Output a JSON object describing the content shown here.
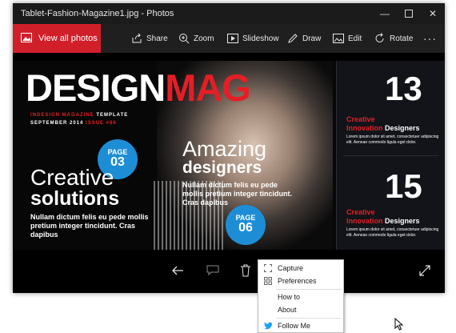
{
  "window": {
    "title": "Tablet-Fashion-Magazine1.jpg - Photos",
    "controls": [
      "minimize",
      "maximize",
      "close"
    ]
  },
  "toolbar": {
    "view_all": "View all photos",
    "share": "Share",
    "zoom": "Zoom",
    "slideshow": "Slideshow",
    "draw": "Draw",
    "edit": "Edit",
    "rotate": "Rotate",
    "more": "···"
  },
  "image": {
    "title_white": "DESIGN",
    "title_red": "MAG",
    "subtitle_white": "INDESIGN MAGAZINE",
    "subtitle_red_word": "TEMPLATE",
    "date_white": "SEPTEMBER 2014",
    "date_red": "ISSUE #86",
    "badge1_label": "PAGE",
    "badge1_number": "03",
    "badge2_label": "PAGE",
    "badge2_number": "06",
    "left_heading1": "Creative",
    "left_heading2": "solutions",
    "left_body": "Nullam dictum felis eu pede mollis pretium integer tincidunt. Cras dapibus",
    "center_heading1": "Amazing",
    "center_heading2": "designers",
    "center_body": "Nullam dictum felis eu pede mollis pretium integer tincidunt. Cras dapibus",
    "right_number1": "13",
    "right_number2": "15",
    "right_creative": "Creative",
    "right_innovation": "Innovation",
    "right_designers": "Designers",
    "right_body": "Lorem ipsum dolor sit amet, consectetuer adipiscing elit. Aenean commodo ligula eget dolor."
  },
  "context_menu": {
    "items": [
      {
        "label": "Capture",
        "icon": "capture-icon"
      },
      {
        "label": "Preferences",
        "icon": "grid-icon"
      },
      {
        "label": "How to",
        "icon": ""
      },
      {
        "label": "About",
        "icon": ""
      },
      {
        "label": "Follow Me",
        "icon": "twitter-icon"
      }
    ]
  },
  "colors": {
    "accent_red": "#d11f2a",
    "magazine_red": "#e51e25",
    "badge_blue": "#1d8ed6",
    "twitter_blue": "#1da1f2"
  }
}
